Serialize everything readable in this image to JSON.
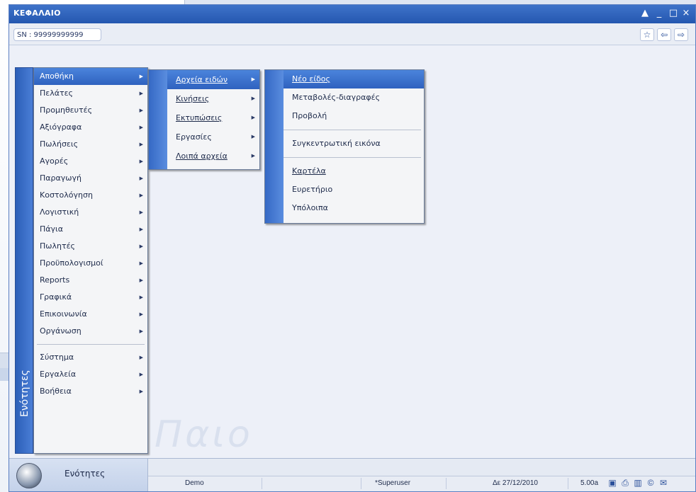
{
  "window": {
    "title": "ΚΕΦΑΛΑΙΟ",
    "controls": [
      "▲",
      "_",
      "□",
      "×"
    ]
  },
  "toolbar": {
    "serial": "SN : 99999999999",
    "icons": [
      "star-icon",
      "arrow-left-icon",
      "arrow-right-icon"
    ]
  },
  "sideband_label": "Ενότητες",
  "menu_main": {
    "items": [
      {
        "label": "Αποθήκη"
      },
      {
        "label": "Πελάτες"
      },
      {
        "label": "Προμηθευτές"
      },
      {
        "label": "Αξιόγραφα"
      },
      {
        "label": "Πωλήσεις"
      },
      {
        "label": "Αγορές"
      },
      {
        "label": "Παραγωγή"
      },
      {
        "label": "Κοστολόγηση"
      },
      {
        "label": "Λογιστική"
      },
      {
        "label": "Πάγια"
      },
      {
        "label": "Πωλητές"
      },
      {
        "label": "Προϋπολογισμοί"
      },
      {
        "label": "Reports"
      },
      {
        "label": "Γραφικά"
      },
      {
        "label": "Επικοινωνία"
      },
      {
        "label": "Οργάνωση"
      },
      {
        "label": "Σύστημα"
      },
      {
        "label": "Εργαλεία"
      },
      {
        "label": "Βοήθεια"
      }
    ]
  },
  "menu_sub": {
    "items": [
      {
        "label": "Αρχεία ειδών"
      },
      {
        "label": "Κινήσεις"
      },
      {
        "label": "Εκτυπώσεις"
      },
      {
        "label": "Εργασίες"
      },
      {
        "label": "Λοιπά αρχεία"
      }
    ]
  },
  "menu_items": {
    "items": [
      {
        "label": "Νέο είδος"
      },
      {
        "label": "Μεταβολές-διαγραφές"
      },
      {
        "label": "Προβολή"
      },
      {
        "label": "Συγκεντρωτική εικόνα"
      },
      {
        "label": "Καρτέλα"
      },
      {
        "label": "Ευρετήριο"
      },
      {
        "label": "Υπόλοιπα"
      }
    ]
  },
  "watermark": "Παιο",
  "start": {
    "label": "Ενότητες"
  },
  "status": {
    "company": "Demo",
    "user": "*Superuser",
    "date": "Δε 27/12/2010",
    "version": "5.00a"
  }
}
